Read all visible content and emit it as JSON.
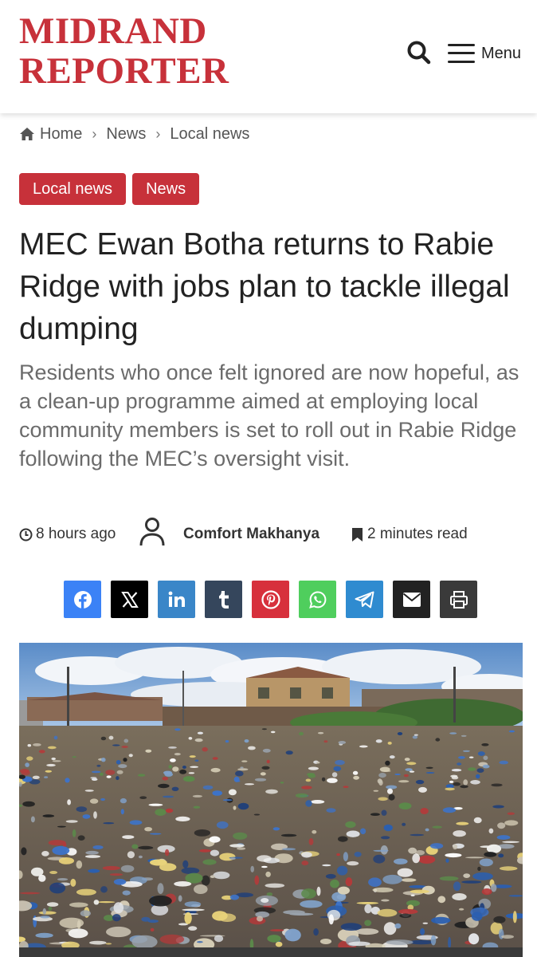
{
  "site": {
    "logo_line1": "MIDRAND",
    "logo_line2": "REPORTER",
    "menu_label": "Menu",
    "brand_color": "#c7313a"
  },
  "breadcrumb": {
    "home": "Home",
    "sep1": "›",
    "level1": "News",
    "sep2": "›",
    "level2": "Local news"
  },
  "tags": [
    "Local news",
    "News"
  ],
  "article": {
    "headline": "MEC Ewan Botha returns to Rabie Ridge with jobs plan to tackle illegal dumping",
    "subhead": "Residents who once felt ignored are now hopeful, as a clean-up programme aimed at employing local community members is set to roll out in Rabie Ridge following the MEC’s oversight visit.",
    "time": "8 hours ago",
    "author": "Comfort Makhanya",
    "read_time": "2 minutes read"
  },
  "share": [
    {
      "icon": "facebook-icon",
      "color": "#3b82f6"
    },
    {
      "icon": "x-icon",
      "color": "#000000"
    },
    {
      "icon": "linkedin-icon",
      "color": "#3a86c8"
    },
    {
      "icon": "tumblr-icon",
      "color": "#35465c"
    },
    {
      "icon": "pinterest-icon",
      "color": "#d7303c"
    },
    {
      "icon": "whatsapp-icon",
      "color": "#4fce5d"
    },
    {
      "icon": "telegram-icon",
      "color": "#2f8bd0"
    },
    {
      "icon": "email-icon",
      "color": "#222222"
    },
    {
      "icon": "print-icon",
      "color": "#3a3a3a"
    }
  ]
}
